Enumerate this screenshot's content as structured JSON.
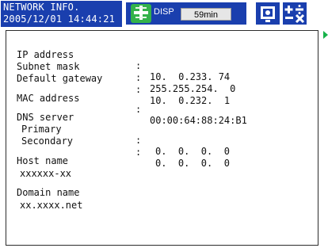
{
  "header": {
    "title": "NETWORK INFO.",
    "datetime": "2005/12/01 14:44:21",
    "disp_label": "DISP",
    "time_button": "59min"
  },
  "network": {
    "ip_label": "IP address",
    "ip_value": "10.  0.233. 74",
    "subnet_label": "Subnet mask",
    "subnet_value": "255.255.254.  0",
    "gateway_label": "Default gateway",
    "gateway_value": "10.  0.232.  1",
    "mac_label": "MAC address",
    "mac_value": "00:00:64:88:24:B1",
    "dns_label": "DNS server",
    "primary_label": "Primary",
    "primary_value": "0.  0.  0.  0",
    "secondary_label": "Secondary",
    "secondary_value": "0.  0.  0.  0",
    "host_label": "Host name",
    "host_value": "xxxxxx-xx",
    "domain_label": "Domain name",
    "domain_value": "xx.xxxx.net"
  },
  "separator": ":",
  "colors": {
    "accent_blue": "#1a3fae",
    "disp_green": "#34b24a",
    "play_green": "#16b24a"
  },
  "icons": [
    "disp-icon",
    "display-box-icon",
    "calculator-icon",
    "play-arrow-icon"
  ]
}
